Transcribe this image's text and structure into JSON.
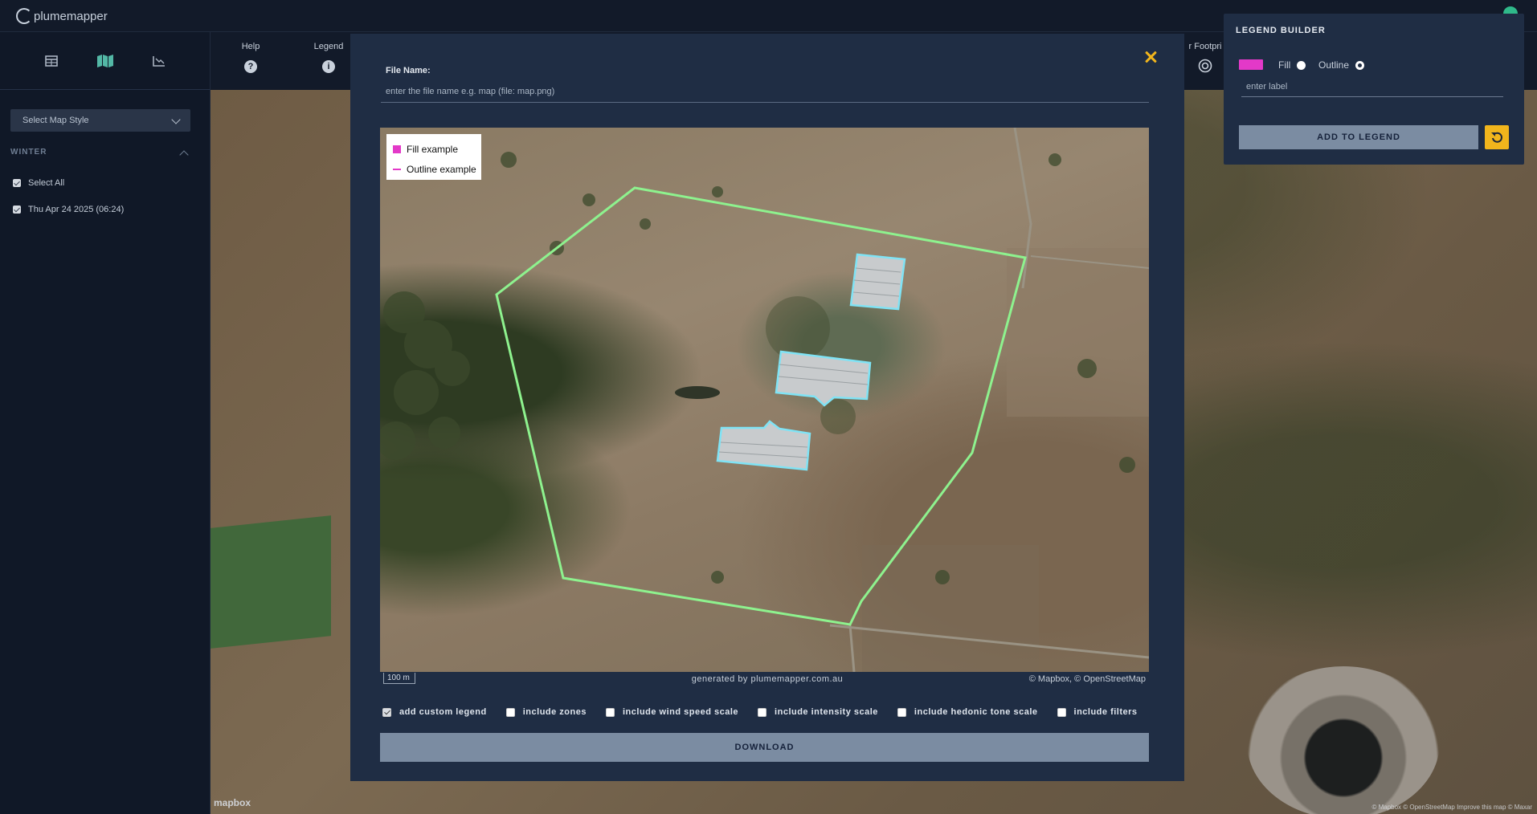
{
  "app": {
    "logo_text": "plumemapper"
  },
  "toolbar": {
    "help_label": "Help",
    "legend_label": "Legend",
    "footprint_label": "r Footpri"
  },
  "sidebar": {
    "map_style_label": "Select Map Style",
    "section_title": "WINTER",
    "items": [
      {
        "label": "Select All",
        "checked": true
      },
      {
        "label": "Thu Apr 24 2025 (06:24)",
        "checked": true
      }
    ]
  },
  "modal": {
    "file_name_label": "File Name:",
    "file_name_placeholder": "enter the file name e.g. map (file: map.png)",
    "file_name_value": "",
    "legend": {
      "fill_label": "Fill example",
      "outline_label": "Outline example",
      "color": "#e339c8"
    },
    "scale_label": "100 m",
    "generated_by": "generated by plumemapper.com.au",
    "attribution": "© Mapbox, © OpenStreetMap",
    "options": [
      {
        "label": "add custom legend",
        "checked": true
      },
      {
        "label": "include zones",
        "checked": false
      },
      {
        "label": "include wind speed scale",
        "checked": false
      },
      {
        "label": "include intensity scale",
        "checked": false
      },
      {
        "label": "include hedonic tone scale",
        "checked": false
      },
      {
        "label": "include filters",
        "checked": false
      }
    ],
    "download_label": "DOWNLOAD"
  },
  "legend_builder": {
    "title": "LEGEND BUILDER",
    "swatch_color": "#e339c8",
    "fill_label": "Fill",
    "outline_label": "Outline",
    "selected": "Outline",
    "label_placeholder": "enter label",
    "add_label": "ADD TO LEGEND"
  },
  "map": {
    "mapbox_watermark": "mapbox",
    "attribution_right": "© Mapbox © OpenStreetMap  Improve this map © Maxar",
    "scale_right": "100 m",
    "zone_color": "#8ef28e",
    "building_color": "#7fe3f5"
  }
}
